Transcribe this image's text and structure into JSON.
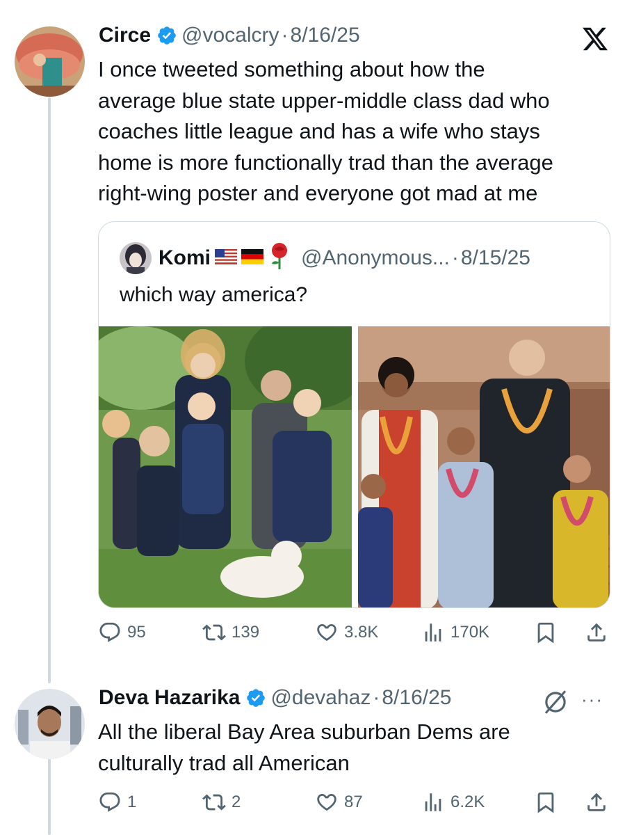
{
  "tweet1": {
    "name": "Circe",
    "handle": "@vocalcry",
    "date": "8/16/25",
    "text": "I once tweeted something about how the\naverage blue state upper-middle class dad who\ncoaches little league and has a wife who stays\nhome is more functionally trad than the average\nright-wing poster and everyone got mad at me",
    "stats": {
      "replies": "95",
      "reposts": "139",
      "likes": "3.8K",
      "views": "170K"
    }
  },
  "quote": {
    "name": "Komi",
    "name_emojis": [
      "us-flag",
      "germany-flag",
      "rose"
    ],
    "handle": "@Anonymous...",
    "date": "8/15/25",
    "text": "which way america?",
    "images": [
      "family-photo-garden",
      "family-photo-temple"
    ]
  },
  "tweet2": {
    "name": "Deva Hazarika",
    "handle": "@devahaz",
    "date": "8/16/25",
    "text": "All the liberal Bay Area suburban Dems are\nculturally trad all American",
    "stats": {
      "replies": "1",
      "reposts": "2",
      "likes": "87",
      "views": "6.2K"
    }
  },
  "ui": {
    "separator": "·",
    "more": "···"
  },
  "colors": {
    "verified": "#1d9bf0",
    "muted": "#536471",
    "text": "#0f1419",
    "border": "#cfd9de"
  },
  "icons": [
    "x-logo-icon",
    "verified-badge-icon",
    "reply-icon",
    "repost-icon",
    "like-icon",
    "views-icon",
    "bookmark-icon",
    "share-icon",
    "grok-icon",
    "more-icon"
  ]
}
